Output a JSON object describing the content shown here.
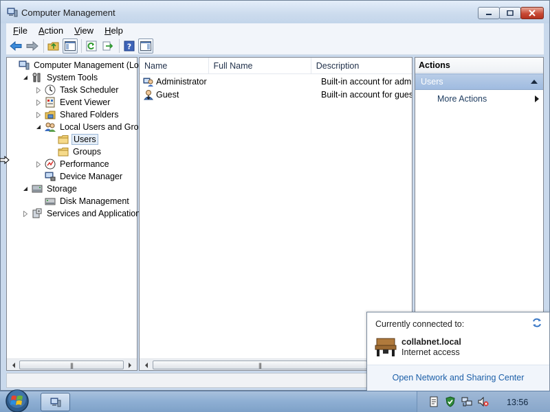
{
  "window": {
    "title": "Computer Management"
  },
  "menu": {
    "items": [
      {
        "label": "File",
        "accel": "F"
      },
      {
        "label": "Action",
        "accel": "A"
      },
      {
        "label": "View",
        "accel": "V"
      },
      {
        "label": "Help",
        "accel": "H"
      }
    ]
  },
  "toolbar": {
    "icons": [
      "back-icon",
      "forward-icon",
      "up-folder-icon",
      "show-hide-console-tree-icon",
      "refresh-icon",
      "export-list-icon",
      "help-icon",
      "show-hide-action-pane-icon"
    ]
  },
  "tree": {
    "items": [
      {
        "label": "Computer Management (Local",
        "icon": "computer-management-icon",
        "expander": "none",
        "depth": 0
      },
      {
        "label": "System Tools",
        "icon": "system-tools-icon",
        "expander": "expanded",
        "depth": 1
      },
      {
        "label": "Task Scheduler",
        "icon": "clock-icon",
        "expander": "collapsed",
        "depth": 2
      },
      {
        "label": "Event Viewer",
        "icon": "event-viewer-icon",
        "expander": "collapsed",
        "depth": 2
      },
      {
        "label": "Shared Folders",
        "icon": "shared-folders-icon",
        "expander": "collapsed",
        "depth": 2
      },
      {
        "label": "Local Users and Groups",
        "icon": "users-groups-icon",
        "expander": "expanded",
        "depth": 2
      },
      {
        "label": "Users",
        "icon": "folder-icon",
        "expander": "none",
        "depth": 3,
        "selected": true
      },
      {
        "label": "Groups",
        "icon": "folder-icon",
        "expander": "none",
        "depth": 3
      },
      {
        "label": "Performance",
        "icon": "performance-icon",
        "expander": "collapsed",
        "depth": 2
      },
      {
        "label": "Device Manager",
        "icon": "device-manager-icon",
        "expander": "none",
        "depth": 2
      },
      {
        "label": "Storage",
        "icon": "storage-icon",
        "expander": "expanded",
        "depth": 1
      },
      {
        "label": "Disk Management",
        "icon": "disk-management-icon",
        "expander": "none",
        "depth": 2
      },
      {
        "label": "Services and Applications",
        "icon": "services-icon",
        "expander": "collapsed",
        "depth": 1
      }
    ]
  },
  "list": {
    "columns": [
      "Name",
      "Full Name",
      "Description"
    ],
    "rows": [
      {
        "name": "Administrator",
        "full_name": "",
        "description": "Built-in account for administering",
        "icon": "user-admin-icon"
      },
      {
        "name": "Guest",
        "full_name": "",
        "description": "Built-in account for guest access",
        "icon": "user-guest-icon"
      }
    ]
  },
  "actions": {
    "title": "Actions",
    "section": "Users",
    "items": [
      {
        "label": "More Actions"
      }
    ]
  },
  "network_popup": {
    "heading": "Currently connected to:",
    "network_name": "collabnet.local",
    "status": "Internet access",
    "link": "Open Network and Sharing Center"
  },
  "taskbar": {
    "clock": "13:56",
    "tray_icons": [
      "document-icon",
      "security-check-icon",
      "network-icon",
      "volume-muted-icon"
    ]
  },
  "colors": {
    "selection_blue": "#9fbbe0",
    "link_blue": "#1c5fa8",
    "close_red": "#c84a35"
  }
}
